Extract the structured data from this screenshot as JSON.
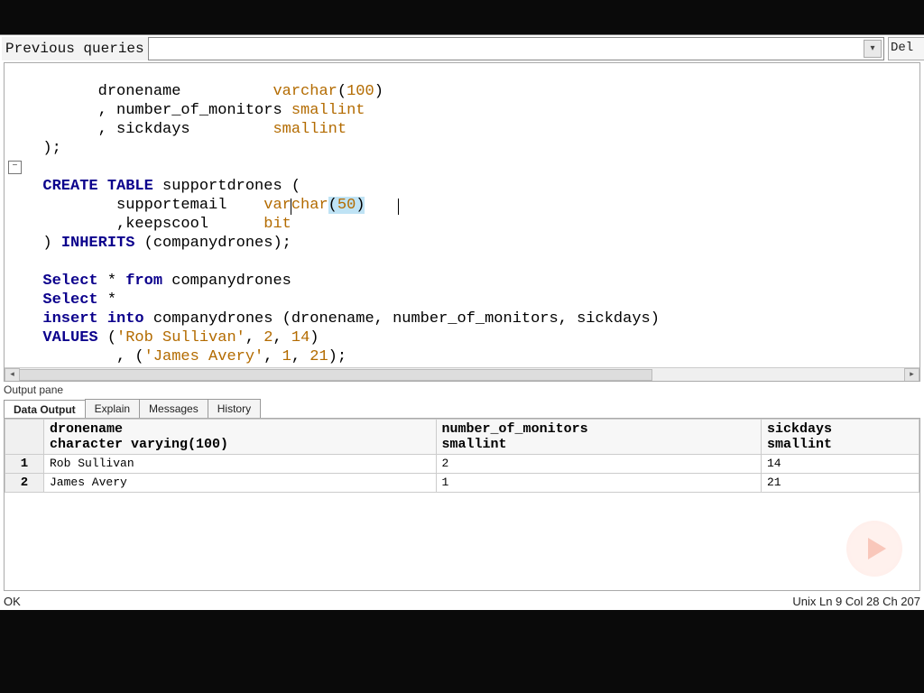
{
  "toolbar": {
    "prev_label": "Previous queries",
    "dropdown_value": "",
    "delete_label": "Del"
  },
  "code": {
    "l1a": "        dronename          ",
    "l1b": "varchar",
    "l1c": "(",
    "l1d": "100",
    "l1e": ")",
    "l2a": "        , number_of_monitors ",
    "l2b": "smallint",
    "l3a": "        , sickdays         ",
    "l3b": "smallint",
    "l4": "  );",
    "l5": "",
    "l6a": "  ",
    "l6b": "CREATE TABLE",
    "l6c": " supportdrones (",
    "l7a": "          supportemail    ",
    "l7b": "varchar",
    "l7c": "(",
    "l7d": "50",
    "l7e": ")",
    "l8a": "          ,keepscool      ",
    "l8b": "bit",
    "l9a": "  ) ",
    "l9b": "INHERITS",
    "l9c": " (companydrones);",
    "l10": "",
    "l11a": "  ",
    "l11b": "Select",
    "l11c": " * ",
    "l11d": "from",
    "l11e": " companydrones",
    "l12a": "  ",
    "l12b": "Select",
    "l12c": " *",
    "l13a": "  ",
    "l13b": "insert into",
    "l13c": " companydrones (dronename, number_of_monitors, sickdays)",
    "l14a": "  ",
    "l14b": "VALUES",
    "l14c": " (",
    "l14d": "'Rob Sullivan'",
    "l14e": ", ",
    "l14f": "2",
    "l14g": ", ",
    "l14h": "14",
    "l14i": ")",
    "l15a": "          , (",
    "l15b": "'James Avery'",
    "l15c": ", ",
    "l15d": "1",
    "l15e": ", ",
    "l15f": "21",
    "l15g": ");"
  },
  "output": {
    "pane_label": "Output pane",
    "tabs": [
      "Data Output",
      "Explain",
      "Messages",
      "History"
    ],
    "active_tab": 0,
    "columns": [
      {
        "name": "dronename",
        "type": "character varying(100)"
      },
      {
        "name": "number_of_monitors",
        "type": "smallint"
      },
      {
        "name": "sickdays",
        "type": "smallint"
      }
    ],
    "rows": [
      {
        "n": "1",
        "c0": "Rob Sullivan",
        "c1": "2",
        "c2": "14"
      },
      {
        "n": "2",
        "c0": "James Avery",
        "c1": "1",
        "c2": "21"
      }
    ]
  },
  "status": {
    "left": "OK",
    "right": "Unix Ln 9  Col 28  Ch 207"
  }
}
